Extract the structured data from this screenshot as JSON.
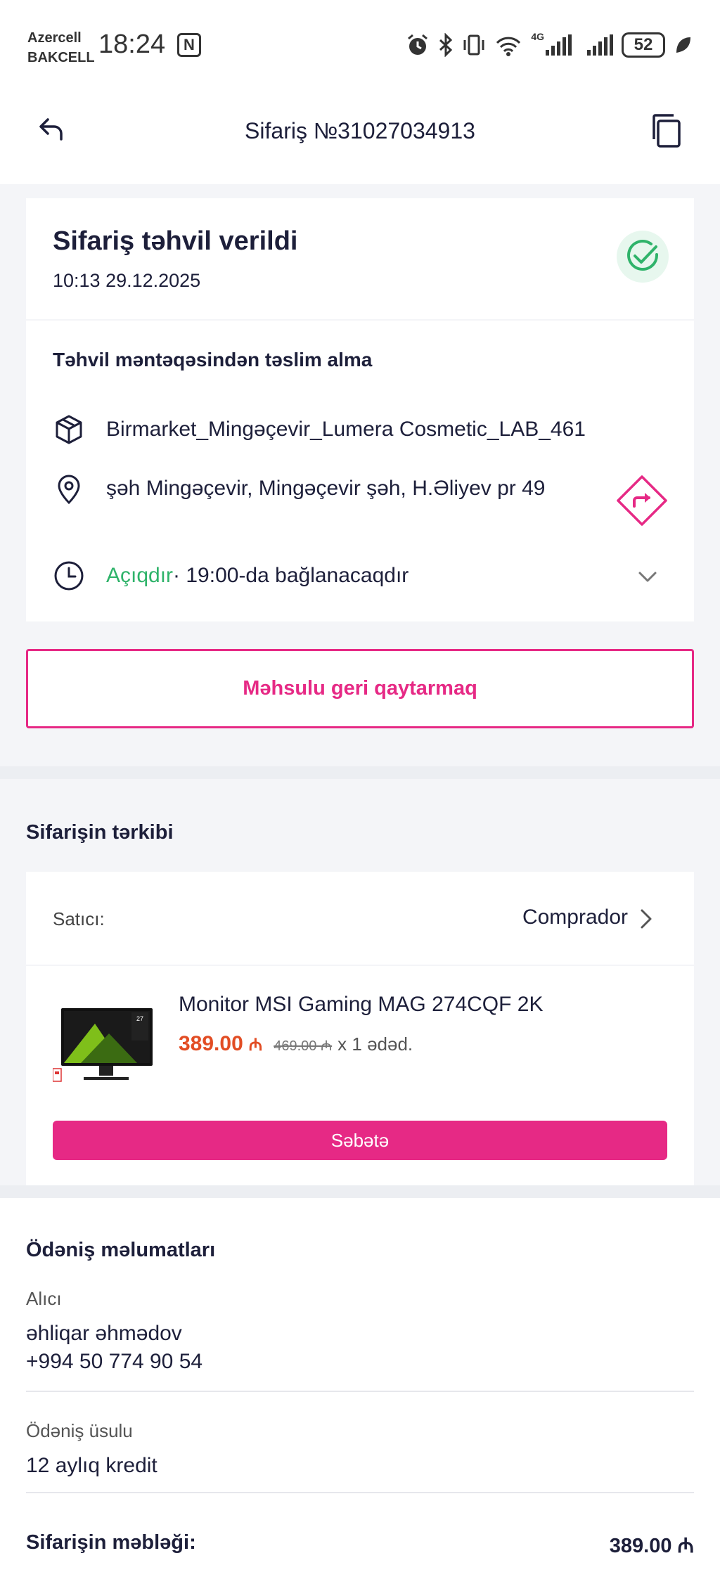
{
  "statusbar": {
    "carrier1": "Azercell",
    "carrier2": "BAKCELL",
    "time": "18:24",
    "nfc": "N",
    "network": "4G",
    "battery": "52"
  },
  "header": {
    "title": "Sifariş №31027034913"
  },
  "status": {
    "title": "Sifariş təhvil verildi",
    "date": "10:13 29.12.2025"
  },
  "pickup": {
    "title": "Təhvil məntəqəsindən təslim alma",
    "point_name": "Birmarket_Mingəçevir_Lumera Cosmetic_LAB_461",
    "address": "şəh Mingəçevir, Mingəçevir şəh, H.Əliyev pr 49",
    "open_status": "Açıqdır",
    "hours": " · 19:00-da bağlanacaqdır"
  },
  "return_button": "Məhsulu geri qaytarmaq",
  "composition": {
    "title": "Sifarişin tərkibi",
    "seller_label": "Satıcı:",
    "seller_name": "Comprador",
    "product": {
      "name": "Monitor MSI Gaming MAG 274CQF 2K",
      "price": "389.00",
      "currency": "₼",
      "old_price": "469.00 ₼",
      "quantity": "x 1 ədəd.",
      "thumb_size": "27"
    },
    "cart_button": "Səbətə"
  },
  "payment": {
    "title": "Ödəniş məlumatları",
    "buyer_label": "Alıcı",
    "buyer_name": "əhliqar əhmədov",
    "buyer_phone": "+994 50 774 90 54",
    "method_label": "Ödəniş üsulu",
    "method_value": "12 aylıq kredit",
    "total_label": "Sifarişin məbləği:",
    "total_value": "389.00 ₼"
  },
  "colors": {
    "accent": "#e62985",
    "success": "#2fb36a",
    "price": "#e24d24"
  }
}
